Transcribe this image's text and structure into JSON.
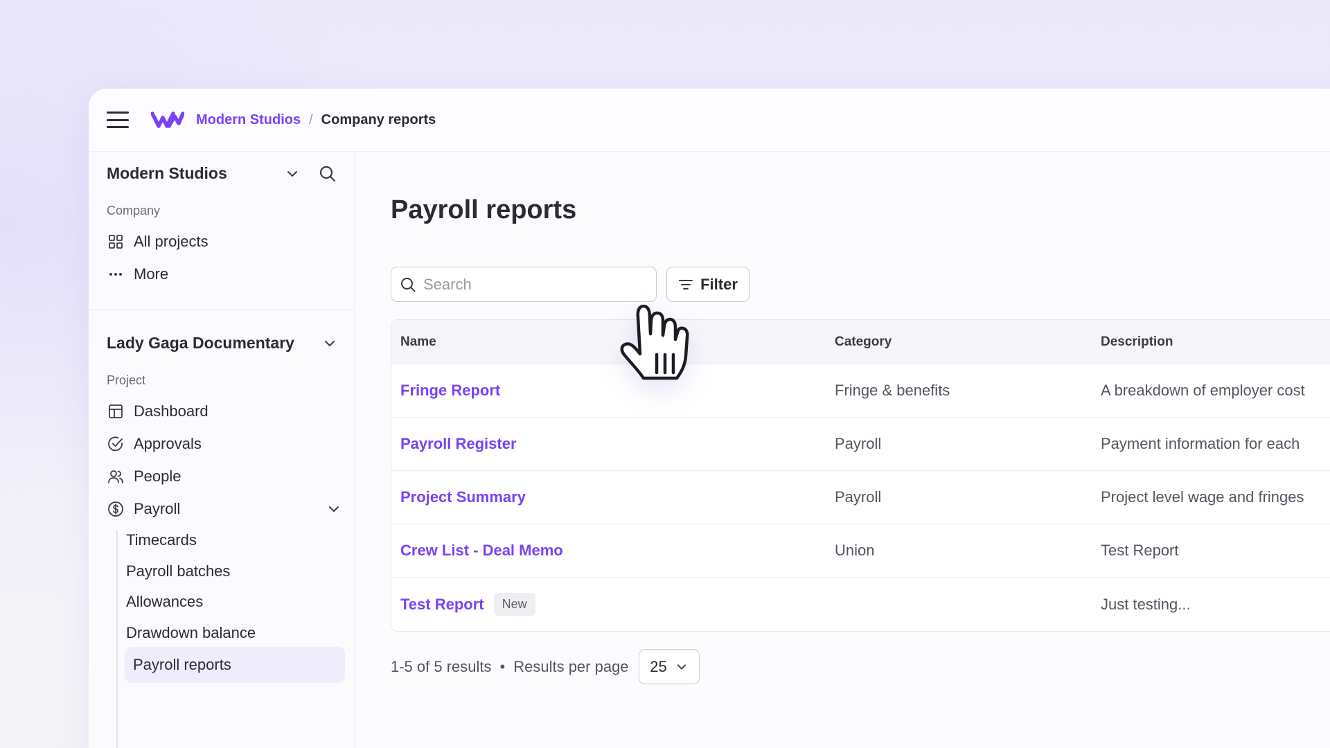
{
  "breadcrumb": {
    "org": "Modern Studios",
    "separator": "/",
    "current": "Company reports"
  },
  "sidebar": {
    "org_section": {
      "title": "Modern Studios",
      "label": "Company",
      "items": [
        {
          "label": "All projects",
          "icon": "grid-icon"
        },
        {
          "label": "More",
          "icon": "more-dots-icon"
        }
      ]
    },
    "project_section": {
      "title": "Lady Gaga Documentary",
      "label": "Project",
      "items": [
        {
          "label": "Dashboard",
          "icon": "layout-icon"
        },
        {
          "label": "Approvals",
          "icon": "check-circle-icon"
        },
        {
          "label": "People",
          "icon": "people-icon"
        },
        {
          "label": "Payroll",
          "icon": "dollar-circle-icon"
        }
      ],
      "payroll_subitems": [
        "Timecards",
        "Payroll batches",
        "Allowances",
        "Drawdown balance",
        "Payroll reports"
      ],
      "active_subitem": "Payroll reports"
    }
  },
  "main": {
    "title": "Payroll reports",
    "search": {
      "placeholder": "Search",
      "value": ""
    },
    "filter_label": "Filter",
    "table": {
      "columns": [
        "Name",
        "Category",
        "Description"
      ],
      "rows": [
        {
          "name": "Fringe Report",
          "category": "Fringe & benefits",
          "description": "A breakdown of employer cost",
          "badge": ""
        },
        {
          "name": "Payroll Register",
          "category": "Payroll",
          "description": "Payment information for each",
          "badge": ""
        },
        {
          "name": "Project Summary",
          "category": "Payroll",
          "description": "Project level wage and fringes",
          "badge": ""
        },
        {
          "name": "Crew List - Deal Memo",
          "category": "Union",
          "description": "Test Report",
          "badge": ""
        },
        {
          "name": "Test Report",
          "category": "",
          "description": "Just testing...",
          "badge": "New"
        }
      ]
    },
    "pagination": {
      "summary": "1-5 of 5 results",
      "dot": "•",
      "per_page_label": "Results per page",
      "per_page_value": "25"
    }
  },
  "colors": {
    "accent": "#7a42f4",
    "text": "#2b2b33",
    "muted": "#6c6c78",
    "active_bg": "#efedfb"
  }
}
